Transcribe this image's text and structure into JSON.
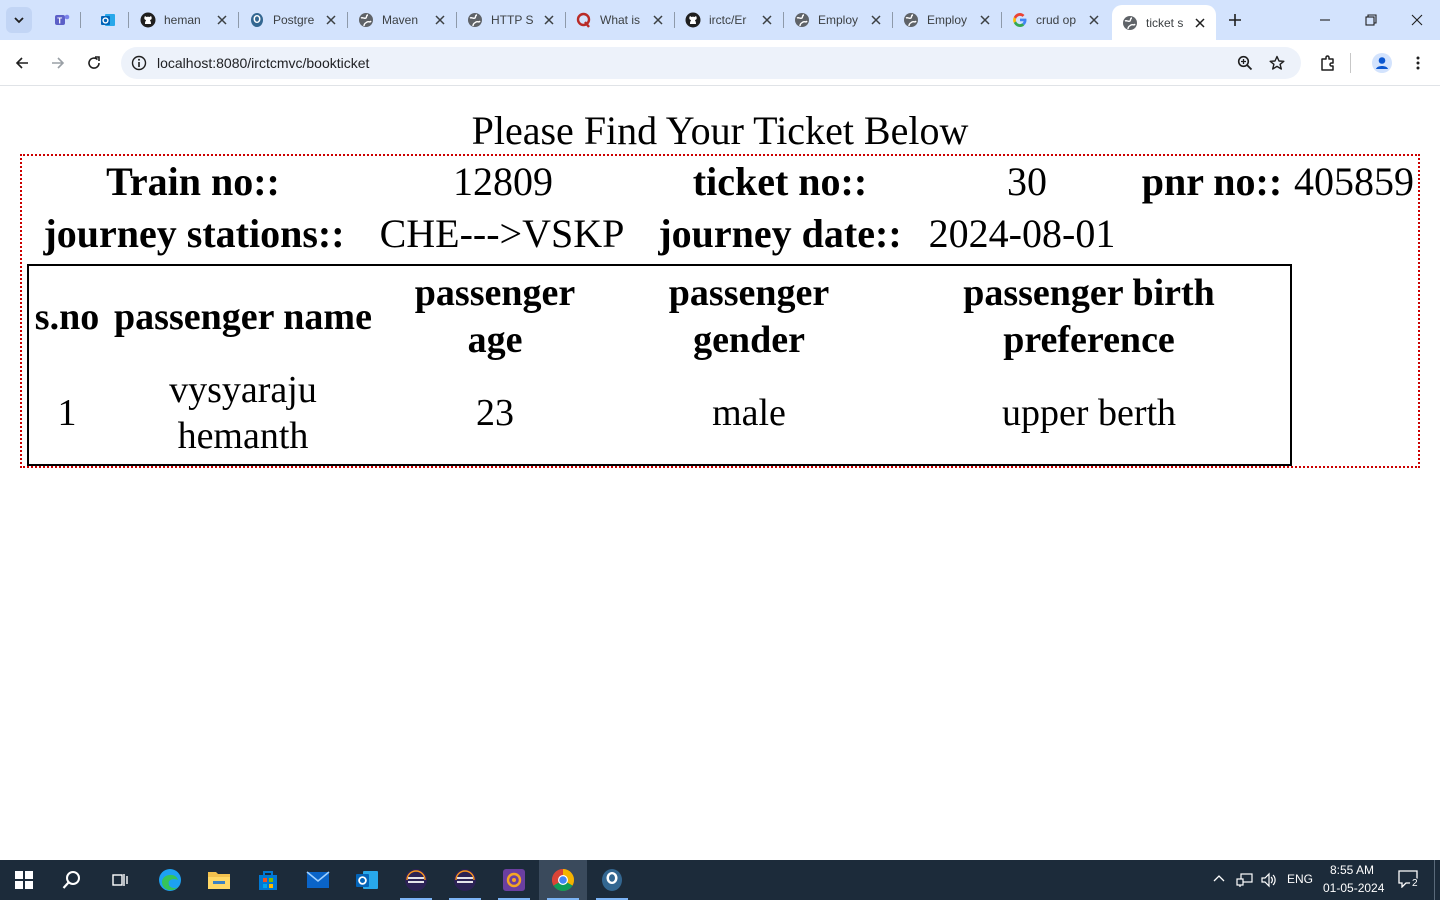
{
  "browser": {
    "tabs": [
      {
        "title": "",
        "favicon": "teams-icon"
      },
      {
        "title": "",
        "favicon": "outlook-icon"
      },
      {
        "title": "heman",
        "favicon": "github-icon"
      },
      {
        "title": "Postgre",
        "favicon": "postgres-icon"
      },
      {
        "title": "Maven",
        "favicon": "globe-icon"
      },
      {
        "title": "HTTP S",
        "favicon": "globe-icon"
      },
      {
        "title": "What is",
        "favicon": "quora-icon"
      },
      {
        "title": "irctc/Er",
        "favicon": "github-icon"
      },
      {
        "title": "Employ",
        "favicon": "globe-icon"
      },
      {
        "title": "Employ",
        "favicon": "globe-icon"
      },
      {
        "title": "crud op",
        "favicon": "google-icon"
      },
      {
        "title": "ticket s",
        "favicon": "globe-icon",
        "active": true
      }
    ],
    "url": "localhost:8080/irctcmvc/bookticket"
  },
  "page": {
    "heading": "Please Find Your Ticket Below",
    "details": {
      "train_no_label": "Train no::",
      "train_no": "12809",
      "ticket_no_label": "ticket no::",
      "ticket_no": "30",
      "pnr_no_label": "pnr no::",
      "pnr_no": "405859",
      "journey_stations_label": "journey stations::",
      "journey_stations": "CHE--->VSKP",
      "journey_date_label": "journey date::",
      "journey_date": "2024-08-01"
    },
    "passenger_table": {
      "headers": [
        "s.no",
        "passenger name",
        "passenger age",
        "passenger gender",
        "passenger birth preference"
      ],
      "rows": [
        [
          "1",
          "vysyaraju hemanth",
          "23",
          "male",
          "upper berth"
        ]
      ]
    }
  },
  "taskbar": {
    "apps": [
      "start-icon",
      "search-icon",
      "task-view-icon",
      "edge-icon",
      "file-explorer-icon",
      "store-icon",
      "mail-icon",
      "outlook-icon",
      "eclipse-icon",
      "eclipse-icon",
      "sts-icon",
      "chrome-icon",
      "pgadmin-icon"
    ],
    "language": "ENG",
    "time": "8:55 AM",
    "date": "01-05-2024",
    "notification_count": "2"
  },
  "colors": {
    "tabstrip": "#d3e3fd",
    "ticket_border": "#cc0000",
    "taskbar": "#1c2b3a"
  }
}
